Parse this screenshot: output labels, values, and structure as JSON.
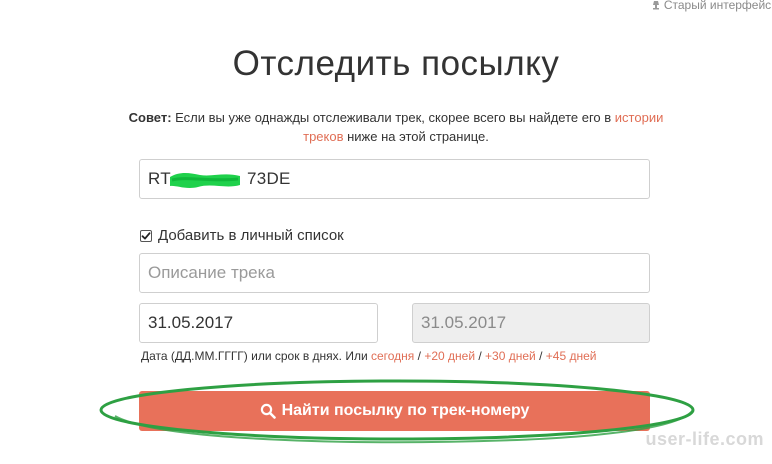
{
  "header": {
    "old_interface_label": "Старый интерфейс т"
  },
  "page": {
    "title": "Отследить посылку"
  },
  "tip": {
    "label": "Совет:",
    "text_before": " Если вы уже однажды отслеживали трек, скорее всего вы найдете его в ",
    "link_text_1": "истории",
    "link_text_2": "треков",
    "text_after": " ниже на этой странице."
  },
  "form": {
    "track_number_value": "RT                   73DE",
    "track_number_visible_prefix": "RT",
    "track_number_visible_suffix": "73DE",
    "add_to_list_label": "Добавить в личный список",
    "add_to_list_checked": true,
    "description_placeholder": "Описание трека",
    "date_from_value": "31.05.2017",
    "date_to_value": "31.05.2017",
    "date_hint_text": "Дата (ДД.ММ.ГГГГ) или срок в днях. Или ",
    "date_shortcuts": [
      "сегодня",
      "+20 дней",
      "+30 дней",
      "+45 дней"
    ],
    "shortcut_separator": " / ",
    "submit_label": "Найти посылку по трек-номеру"
  },
  "watermark": {
    "text": "user-life.com"
  },
  "colors": {
    "accent": "#e8715a",
    "link": "#e06e55",
    "annotation_green": "#2ea043",
    "redaction_green": "#1fd14b"
  },
  "icons": {
    "old_interface": "lamp-icon",
    "submit": "search-icon",
    "checkbox": "checkmark-icon"
  }
}
